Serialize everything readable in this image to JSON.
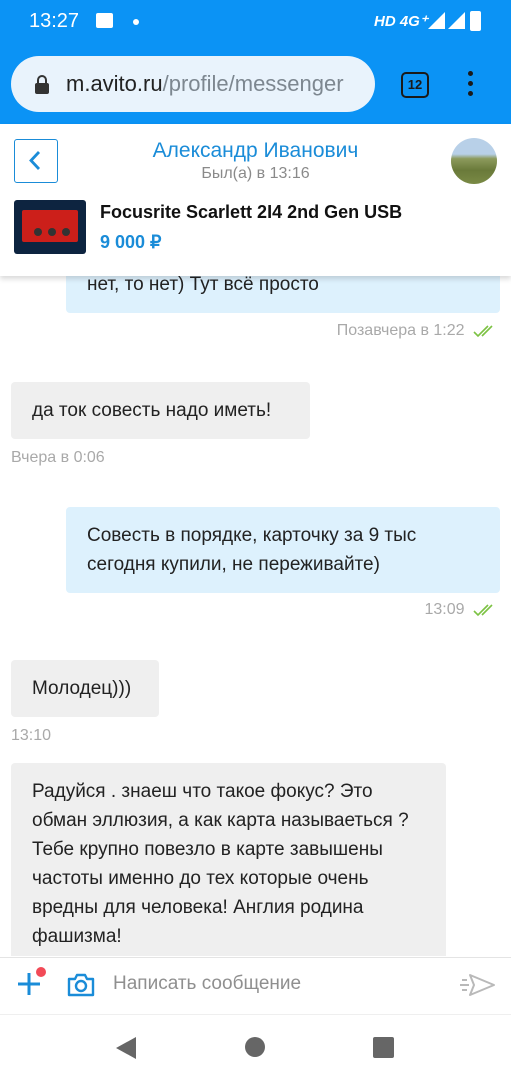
{
  "status_bar": {
    "time": "13:27",
    "network": "HD 4G⁺"
  },
  "browser": {
    "url_domain": "m.avito.ru",
    "url_path": "/profile/messenger",
    "tab_count": "12"
  },
  "header": {
    "contact_name": "Александр Иванович",
    "last_seen": "Был(а) в 13:16",
    "item_title": "Focusrite Scarlett 2I4 2nd Gen USB",
    "item_price": "9 000 ₽"
  },
  "messages": [
    {
      "direction": "out",
      "text": "нет, то нет) Тут всё просто",
      "time": "Позавчера в 1:22",
      "read": true
    },
    {
      "direction": "in",
      "text": "да ток совесть надо иметь!",
      "time": "Вчера в 0:06"
    },
    {
      "direction": "out",
      "text": "Совесть в порядке, карточку за 9 тыс сегодня купили, не переживайте)",
      "time": "13:09",
      "read": true
    },
    {
      "direction": "in",
      "text": "Молодец)))",
      "time": "13:10"
    },
    {
      "direction": "in",
      "text": "Радуйся . знаеш что такое фокус? Это обман эллюзия, а как карта называеться ? Тебе крупно повезло в карте завышены частоты именно до тех которые очень вредны для человека! Англия родина фашизма!",
      "time": ""
    }
  ],
  "composer": {
    "placeholder": "Написать сообщение"
  },
  "colors": {
    "accent": "#0b93f5",
    "link": "#1a8cd8",
    "outgoing_bubble": "#ddf1fd",
    "incoming_bubble": "#efefef",
    "read_ticks": "#7cc243",
    "notification_dot": "#f24a57"
  },
  "icons": [
    "image-icon",
    "lock-icon",
    "tabs-icon",
    "more-menu-icon",
    "back-icon",
    "read-ticks-icon",
    "plus-icon",
    "camera-icon",
    "send-icon"
  ]
}
